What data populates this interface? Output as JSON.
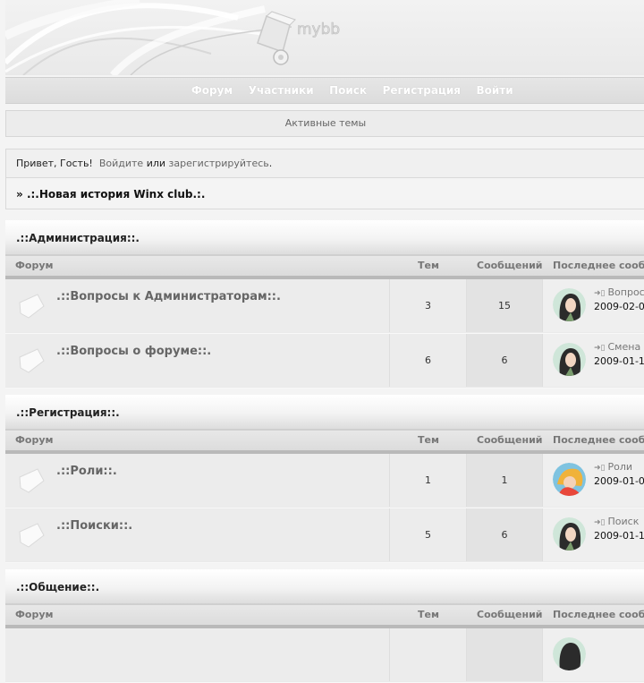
{
  "nav": {
    "items": [
      {
        "label": "Форум"
      },
      {
        "label": "Участники"
      },
      {
        "label": "Поиск"
      },
      {
        "label": "Регистрация"
      },
      {
        "label": "Войти"
      }
    ]
  },
  "active_topics": "Активные темы",
  "greeting": {
    "hello": "Привет, Гость!",
    "login": "Войдите",
    "or": "или",
    "register": "зарегистрируйтесь",
    "end": "."
  },
  "breadcrumb": {
    "prefix": "»",
    "title": ".:.Новая история Winx club.:."
  },
  "columns": {
    "forum": "Форум",
    "topics": "Тем",
    "posts": "Сообщений",
    "last": "Последнее сооб"
  },
  "categories": [
    {
      "title": ".::Администрация::.",
      "forums": [
        {
          "name": ".::Вопросы к Администраторам::.",
          "topics": "3",
          "posts": "15",
          "last_title": "Вопрос",
          "last_date": "2009-02-0",
          "avatar": "girl-dark"
        },
        {
          "name": ".::Вопросы о форуме::.",
          "topics": "6",
          "posts": "6",
          "last_title": "Смена",
          "last_date": "2009-01-1",
          "avatar": "girl-dark"
        }
      ]
    },
    {
      "title": ".::Регистрация::.",
      "forums": [
        {
          "name": ".::Роли::.",
          "topics": "1",
          "posts": "1",
          "last_title": "Роли",
          "last_date": "2009-01-0",
          "avatar": "girl-blond"
        },
        {
          "name": ".::Поиски::.",
          "topics": "5",
          "posts": "6",
          "last_title": "Поиск",
          "last_date": "2009-01-1",
          "avatar": "girl-dark"
        }
      ]
    },
    {
      "title": ".::Общение::.",
      "forums": []
    }
  ],
  "colors": {
    "nav_text": "#ffffff",
    "forum_name": "#666666",
    "link": "#666666"
  }
}
